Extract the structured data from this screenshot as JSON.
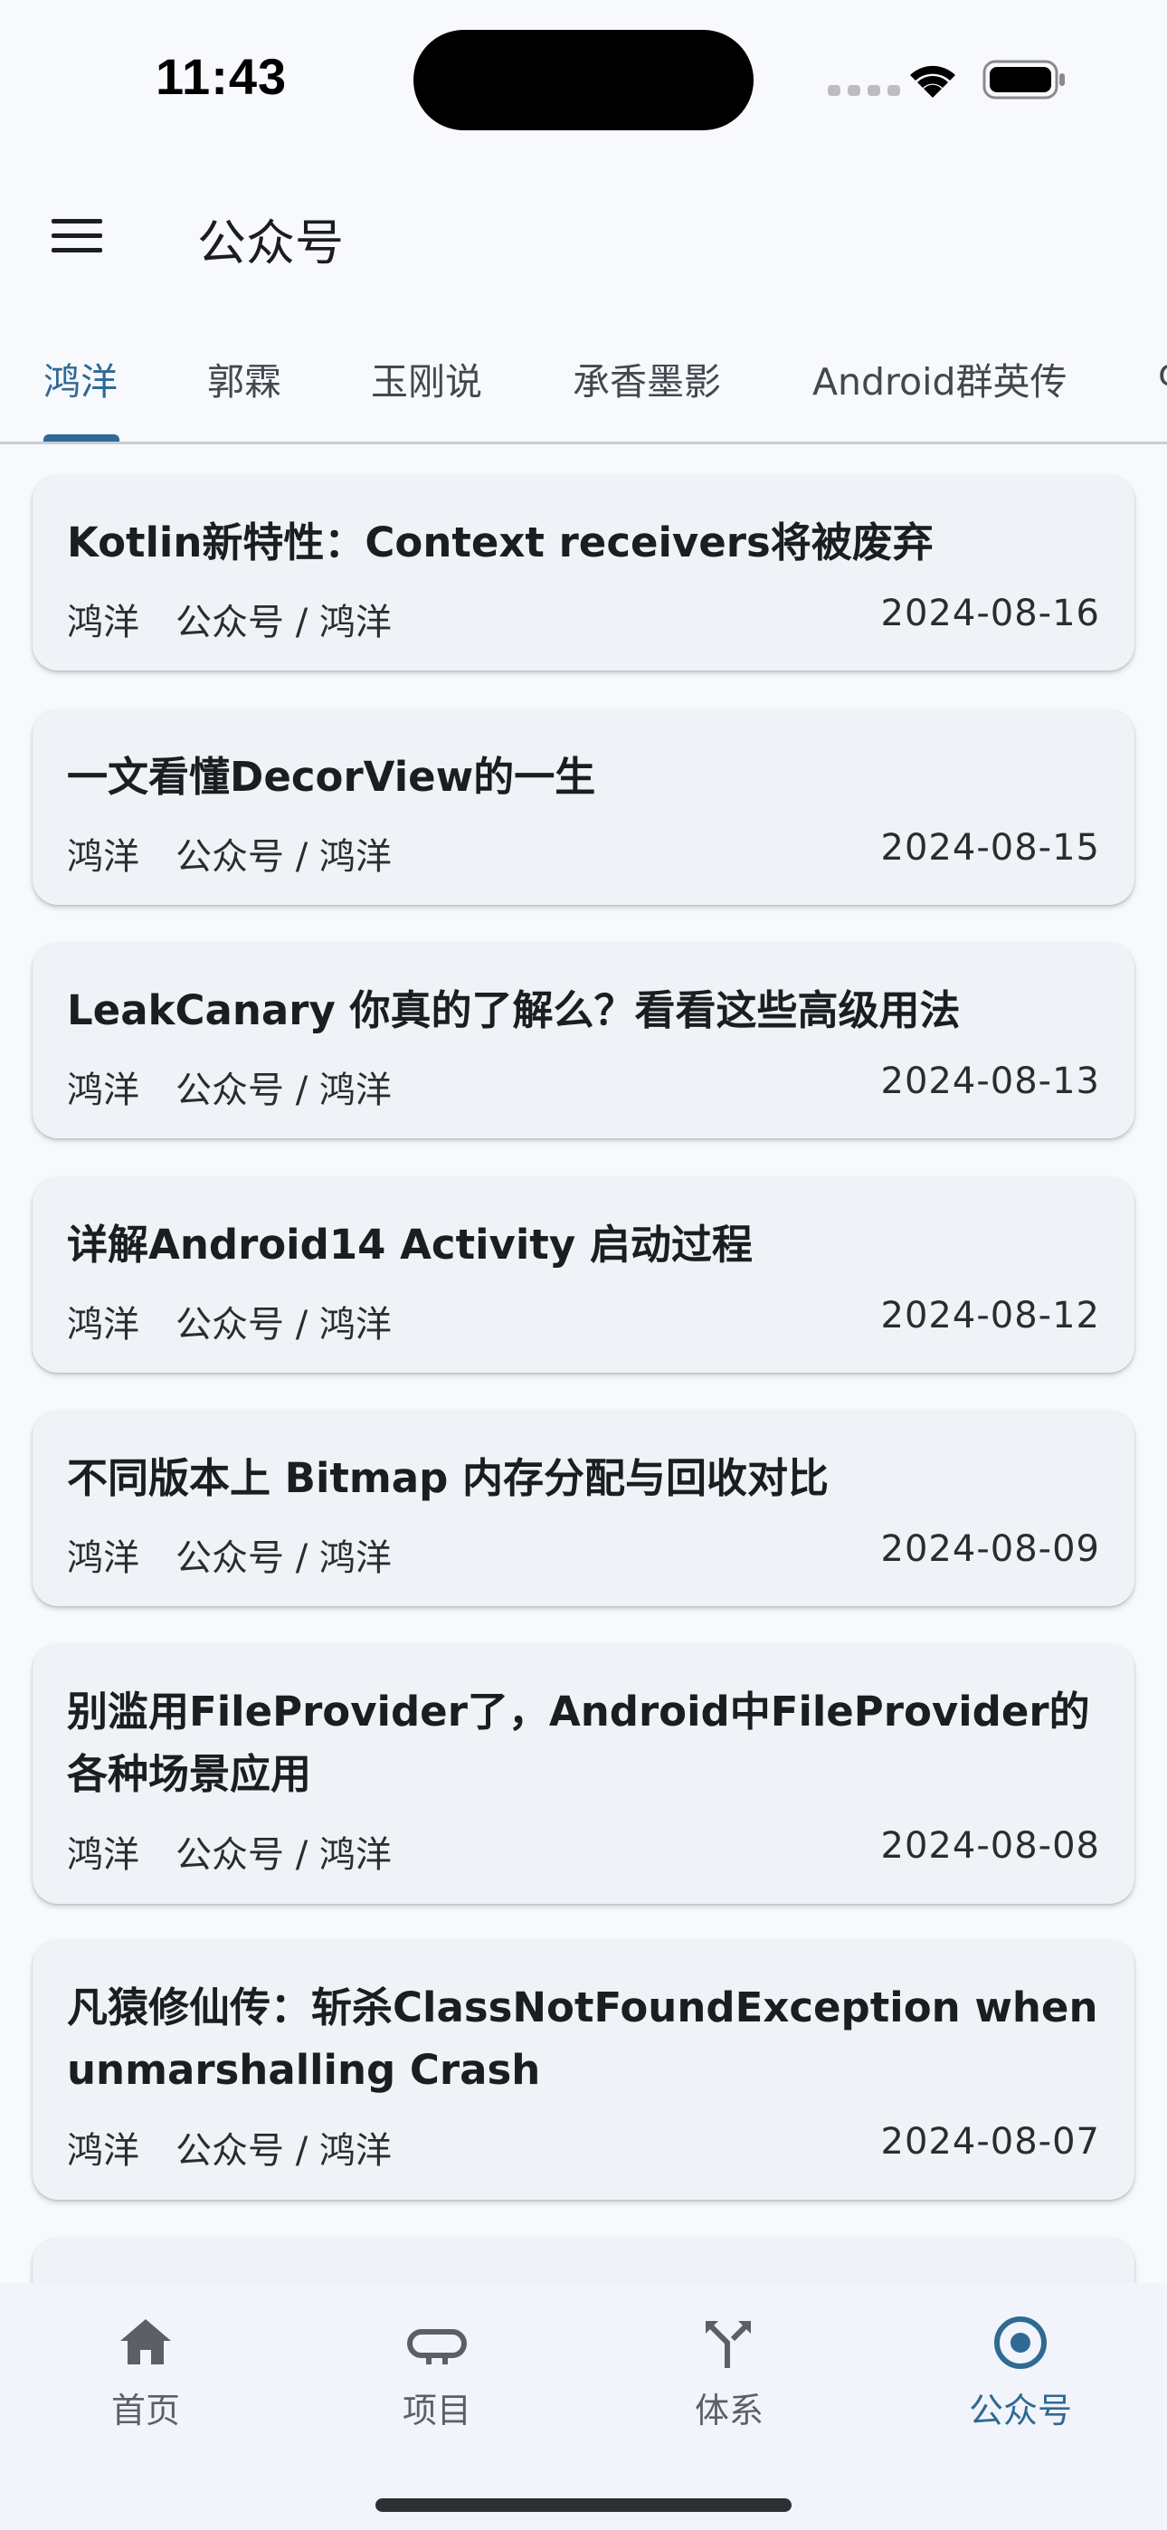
{
  "status_bar": {
    "time": "11:43"
  },
  "app_bar": {
    "title": "公众号",
    "menu_icon": "menu-icon"
  },
  "tabs": [
    {
      "label": "鸿洋",
      "active": true
    },
    {
      "label": "郭霖",
      "active": false
    },
    {
      "label": "玉刚说",
      "active": false
    },
    {
      "label": "承香墨影",
      "active": false
    },
    {
      "label": "Android群英传",
      "active": false
    },
    {
      "label": "c",
      "active": false
    }
  ],
  "articles": [
    {
      "title": "Kotlin新特性：Context receivers将被废弃",
      "author": "鸿洋",
      "chapter": "公众号 / 鸿洋",
      "date": "2024-08-16"
    },
    {
      "title": "一文看懂DecorView的一生",
      "author": "鸿洋",
      "chapter": "公众号 / 鸿洋",
      "date": "2024-08-15"
    },
    {
      "title": "LeakCanary 你真的了解么？看看这些高级用法",
      "author": "鸿洋",
      "chapter": "公众号 / 鸿洋",
      "date": "2024-08-13"
    },
    {
      "title": "详解Android14 Activity 启动过程",
      "author": "鸿洋",
      "chapter": "公众号 / 鸿洋",
      "date": "2024-08-12"
    },
    {
      "title": "不同版本上 Bitmap 内存分配与回收对比",
      "author": "鸿洋",
      "chapter": "公众号 / 鸿洋",
      "date": "2024-08-09"
    },
    {
      "title": "别滥用FileProvider了，Android中FileProvider的各种场景应用",
      "author": "鸿洋",
      "chapter": "公众号 / 鸿洋",
      "date": "2024-08-08"
    },
    {
      "title": "凡猿修仙传：斩杀ClassNotFoundException when unmarshalling Crash",
      "author": "鸿洋",
      "chapter": "公众号 / 鸿洋",
      "date": "2024-08-07"
    }
  ],
  "bottom_nav": [
    {
      "label": "首页",
      "icon": "home-icon",
      "active": false
    },
    {
      "label": "项目",
      "icon": "project-icon",
      "active": false
    },
    {
      "label": "体系",
      "icon": "system-icon",
      "active": false
    },
    {
      "label": "公众号",
      "icon": "official-account-icon",
      "active": true
    }
  ],
  "colors": {
    "accent": "#2F6A93",
    "background": "#F7F9FD",
    "card": "#EFF3F8",
    "text": "#1C1D20"
  }
}
